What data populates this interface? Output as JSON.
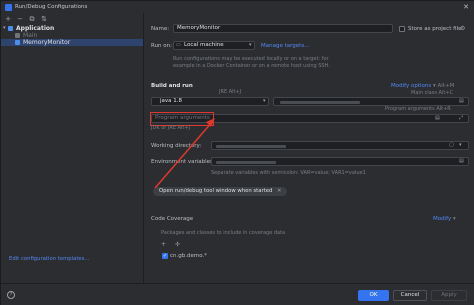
{
  "window": {
    "title": "Run/Debug Configurations",
    "close_glyph": "✕"
  },
  "tree_toolbar": {
    "icons": [
      {
        "name": "add-icon",
        "glyph": "+"
      },
      {
        "name": "remove-icon",
        "glyph": "−"
      },
      {
        "name": "copy-icon",
        "glyph": "⧉"
      },
      {
        "name": "sort-icon",
        "glyph": "⇅"
      }
    ]
  },
  "tree": {
    "application": "Application",
    "main": "Main",
    "memory_monitor": "MemoryMonitor"
  },
  "edit_templates": "Edit configuration templates...",
  "form": {
    "name_label": "Name:",
    "name_value": "MemoryMonitor",
    "store_label": "Store as project file",
    "run_on_label": "Run on:",
    "run_on_value": "Local machine",
    "manage_targets": "Manage targets...",
    "run_on_hint_1": "Run configurations may be executed locally or on a target: for",
    "run_on_hint_2": "example in a Docker Container or on a remote host using SSH.",
    "build_and_run": "Build and run",
    "modify_options": "Modify options",
    "modify_shortcut": "Alt+M",
    "jre_hint": "JRE Alt+J",
    "main_class_hint": "Main class Alt+C",
    "program_args_hint": "Program arguments Alt+R",
    "jdk_value": "java 1.8",
    "program_args_placeholder": "Program arguments",
    "jdk_label": "JDK or JRE Alt+J",
    "working_dir_label": "Working directory:",
    "env_vars_label": "Environment variables:",
    "env_hint": "Separate variables with semicolon: VAR=value; VAR1=value1",
    "open_tool_window": "Open run/debug tool window when started",
    "code_coverage": "Code Coverage",
    "modify": "Modify",
    "packages_label": "Packages and classes to include in coverage data",
    "coverage_pattern": "cn.gb.demo.*"
  },
  "buttons": {
    "ok": "OK",
    "cancel": "Cancel",
    "apply": "Apply",
    "help": "?"
  }
}
